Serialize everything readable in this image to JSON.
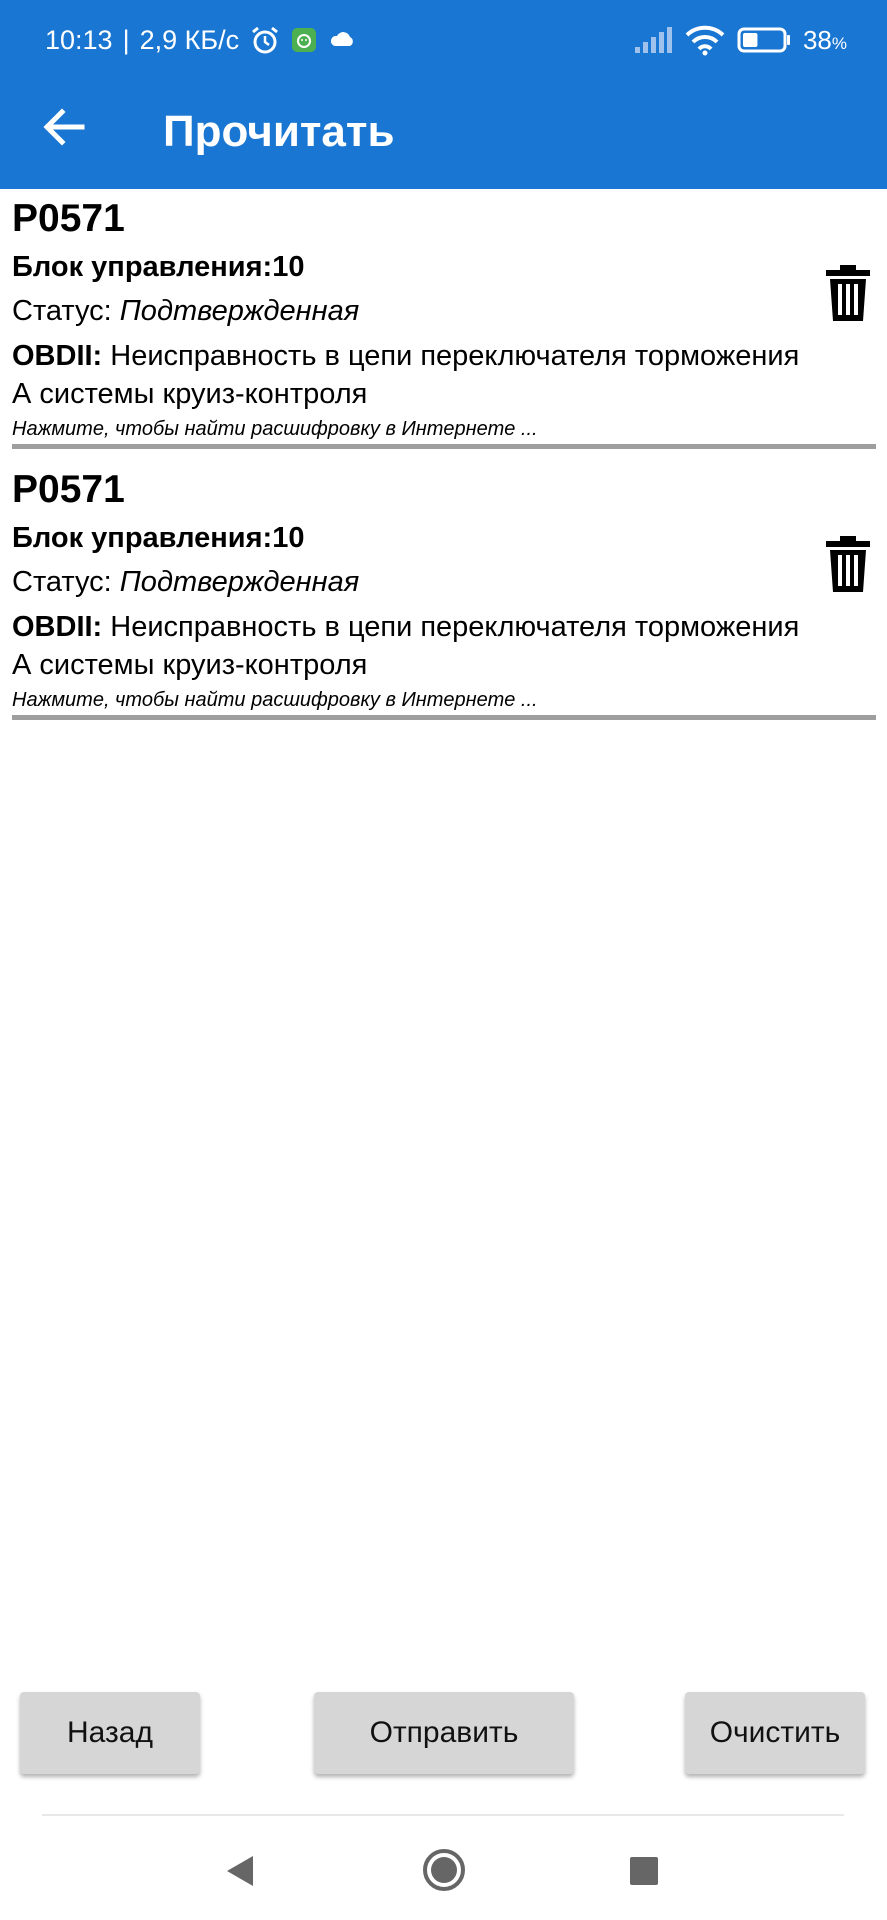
{
  "status_bar": {
    "time": "10:13",
    "separator": "|",
    "net_speed": "2,9 КБ/с",
    "battery_percent": "38",
    "battery_unit": "%",
    "battery_level": 0.38
  },
  "toolbar": {
    "title": "Прочитать"
  },
  "items": [
    {
      "code": "P0571",
      "block_label": "Блок управления:",
      "block_value": "10",
      "status_label": "Статус: ",
      "status_value": "Подтвержденная",
      "desc_key": "OBDII:",
      "desc_text": " Неисправность в цепи переключателя торможения А системы круиз-контроля",
      "hint": "Нажмите, чтобы найти расшифровку в Интернете ..."
    },
    {
      "code": "P0571",
      "block_label": "Блок управления:",
      "block_value": "10",
      "status_label": "Статус: ",
      "status_value": "Подтвержденная",
      "desc_key": "OBDII:",
      "desc_text": " Неисправность в цепи переключателя торможения А системы круиз-контроля",
      "hint": "Нажмите, чтобы найти расшифровку в Интернете ..."
    }
  ],
  "buttons": {
    "back": "Назад",
    "send": "Отправить",
    "clear": "Очистить"
  },
  "colors": {
    "app_bar": "#1976d2",
    "divider": "#9e9e9e",
    "button_bg": "#d6d6d6"
  }
}
